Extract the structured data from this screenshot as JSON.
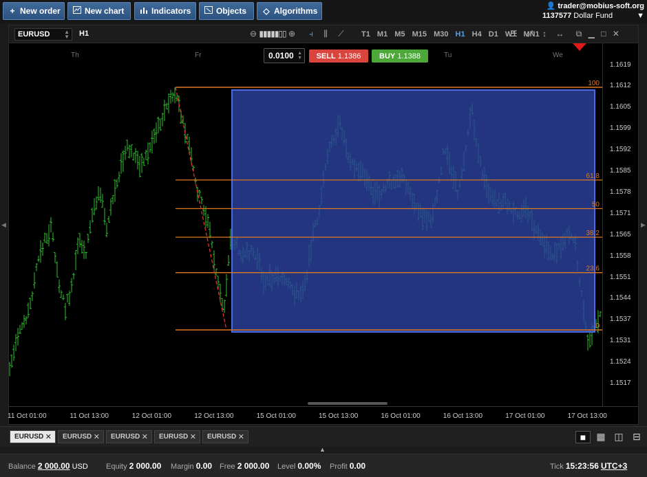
{
  "toolbar": {
    "buttons": [
      {
        "label": "New order",
        "icon": "plus-icon"
      },
      {
        "label": "New chart",
        "icon": "chart-icon"
      },
      {
        "label": "Indicators",
        "icon": "bars-icon"
      },
      {
        "label": "Objects",
        "icon": "objects-icon"
      },
      {
        "label": "Algorithms",
        "icon": "diamond-icon"
      }
    ]
  },
  "account": {
    "user": "trader@mobius-soft.org",
    "number": "1137577",
    "fund": "Dollar Fund"
  },
  "chart": {
    "symbol": "EURUSD",
    "timeframe": "H1",
    "timeframes": [
      "T1",
      "M1",
      "M5",
      "M15",
      "M30",
      "H1",
      "H4",
      "D1",
      "W1",
      "MN1"
    ],
    "active_timeframe": "H1",
    "lot": "0.0100",
    "sell_label": "SELL",
    "sell_price": "1.1386",
    "buy_label": "BUY",
    "buy_price": "1.1388",
    "day_labels": [
      "Th",
      "Fr",
      "Tu",
      "We"
    ],
    "price_ticks": [
      "1.1619",
      "1.1612",
      "1.1605",
      "1.1599",
      "1.1592",
      "1.1585",
      "1.1578",
      "1.1571",
      "1.1565",
      "1.1558",
      "1.1551",
      "1.1544",
      "1.1537",
      "1.1531",
      "1.1524",
      "1.1517"
    ],
    "time_ticks": [
      "11 Oct 01:00",
      "11 Oct 13:00",
      "12 Oct 01:00",
      "12 Oct 13:00",
      "15 Oct 01:00",
      "15 Oct 13:00",
      "16 Oct 01:00",
      "16 Oct 13:00",
      "17 Oct 01:00",
      "17 Oct 13:00"
    ],
    "fib_levels": [
      "100",
      "61.8",
      "50",
      "38.2",
      "23.6",
      "0"
    ],
    "colors": {
      "bullish": "#2fbf2f",
      "fib_line": "#e07a20",
      "rect_fill": "#2b3f9e",
      "rect_border": "#4a6be0",
      "trend": "#e03030",
      "marker": "#e01818"
    }
  },
  "tabs": [
    "EURUSD",
    "EURUSD",
    "EURUSD",
    "EURUSD",
    "EURUSD"
  ],
  "status": {
    "balance_label": "Balance",
    "balance": "2 000.00",
    "currency": "USD",
    "equity_label": "Equity",
    "equity": "2 000.00",
    "margin_label": "Margin",
    "margin": "0.00",
    "free_label": "Free",
    "free": "2 000.00",
    "level_label": "Level",
    "level": "0.00%",
    "profit_label": "Profit",
    "profit": "0.00",
    "tick_label": "Tick",
    "time": "15:23:56",
    "tz": "UTC+3"
  }
}
